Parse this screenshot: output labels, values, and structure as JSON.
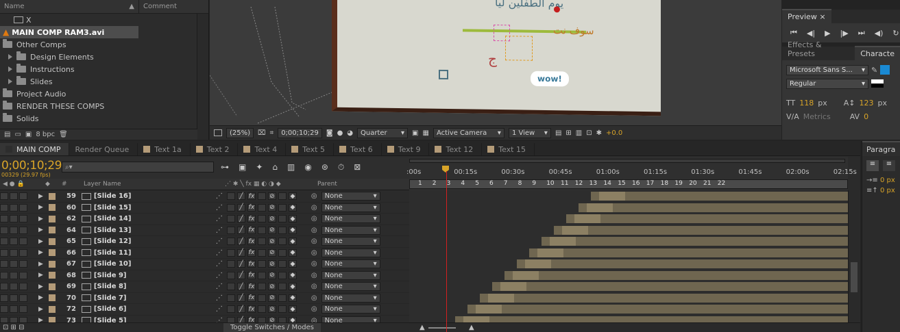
{
  "project": {
    "columns": [
      "Name",
      "Comment"
    ],
    "items": [
      {
        "label": "X",
        "type": "comp"
      },
      {
        "label": "MAIN COMP RAM3.avi",
        "type": "file",
        "selected": true
      },
      {
        "label": "Other Comps",
        "type": "folder"
      },
      {
        "label": "Design Elements",
        "type": "folder"
      },
      {
        "label": "Instructions",
        "type": "folder"
      },
      {
        "label": "Slides",
        "type": "folder"
      },
      {
        "label": "Project Audio",
        "type": "folder"
      },
      {
        "label": "RENDER THESE COMPS",
        "type": "folder"
      },
      {
        "label": "Solids",
        "type": "folder"
      }
    ],
    "bpc": "8 bpc"
  },
  "viewer": {
    "zoom": "(25%)",
    "timecode": "0;00;10;29",
    "resolution": "Quarter",
    "camera": "Active Camera",
    "views": "1 View",
    "exposure": "+0.0",
    "artwork": {
      "badge": "wow!",
      "arabic": "سوف نت",
      "arabic_top": "يوم الطفلين ليا"
    }
  },
  "right": {
    "preview_tab": "Preview",
    "effects_tab": "Effects & Presets",
    "character_tab": "Characte",
    "font": "Microsoft Sans S...",
    "style": "Regular",
    "font_size": "118",
    "font_unit": "px",
    "leading": "123",
    "leading_unit": "px",
    "kerning": "Metrics",
    "tracking": "0"
  },
  "timeline": {
    "tabs": [
      "MAIN COMP",
      "Render Queue",
      "Text 1a",
      "Text 2",
      "Text 4",
      "Text 5",
      "Text 6",
      "Text 9",
      "Text 12",
      "Text 15"
    ],
    "timecode": "0;00;10;29",
    "fps": "00329 (29.97 fps)",
    "col_headers": {
      "hash": "#",
      "layer_name": "Layer Name",
      "parent": "Parent"
    },
    "ruler": [
      ":00s",
      "00:15s",
      "00:30s",
      "00:45s",
      "01:00s",
      "01:15s",
      "01:30s",
      "01:45s",
      "02:00s",
      "02:15s"
    ],
    "markers": [
      "1",
      "2",
      "3",
      "4",
      "5",
      "6",
      "7",
      "8",
      "9",
      "10",
      "11",
      "12",
      "13",
      "14",
      "15",
      "16",
      "17",
      "18",
      "19",
      "20",
      "21",
      "22"
    ],
    "layers": [
      {
        "num": "59",
        "name": "[Slide 16]",
        "parent": "None"
      },
      {
        "num": "60",
        "name": "[Slide 15]",
        "parent": "None"
      },
      {
        "num": "62",
        "name": "[Slide 14]",
        "parent": "None"
      },
      {
        "num": "64",
        "name": "[Slide 13]",
        "parent": "None"
      },
      {
        "num": "65",
        "name": "[Slide 12]",
        "parent": "None"
      },
      {
        "num": "66",
        "name": "[Slide 11]",
        "parent": "None"
      },
      {
        "num": "67",
        "name": "[Slide 10]",
        "parent": "None"
      },
      {
        "num": "68",
        "name": "[Slide 9]",
        "parent": "None"
      },
      {
        "num": "69",
        "name": "[Slide 8]",
        "parent": "None"
      },
      {
        "num": "70",
        "name": "[Slide 7]",
        "parent": "None"
      },
      {
        "num": "72",
        "name": "[Slide 6]",
        "parent": "None"
      },
      {
        "num": "73",
        "name": "[Slide 5]",
        "parent": "None"
      }
    ],
    "toggle_label": "Toggle Switches / Modes"
  },
  "paragraph": {
    "tab": "Paragra",
    "indent1": "0 px",
    "indent2": "0 px"
  }
}
